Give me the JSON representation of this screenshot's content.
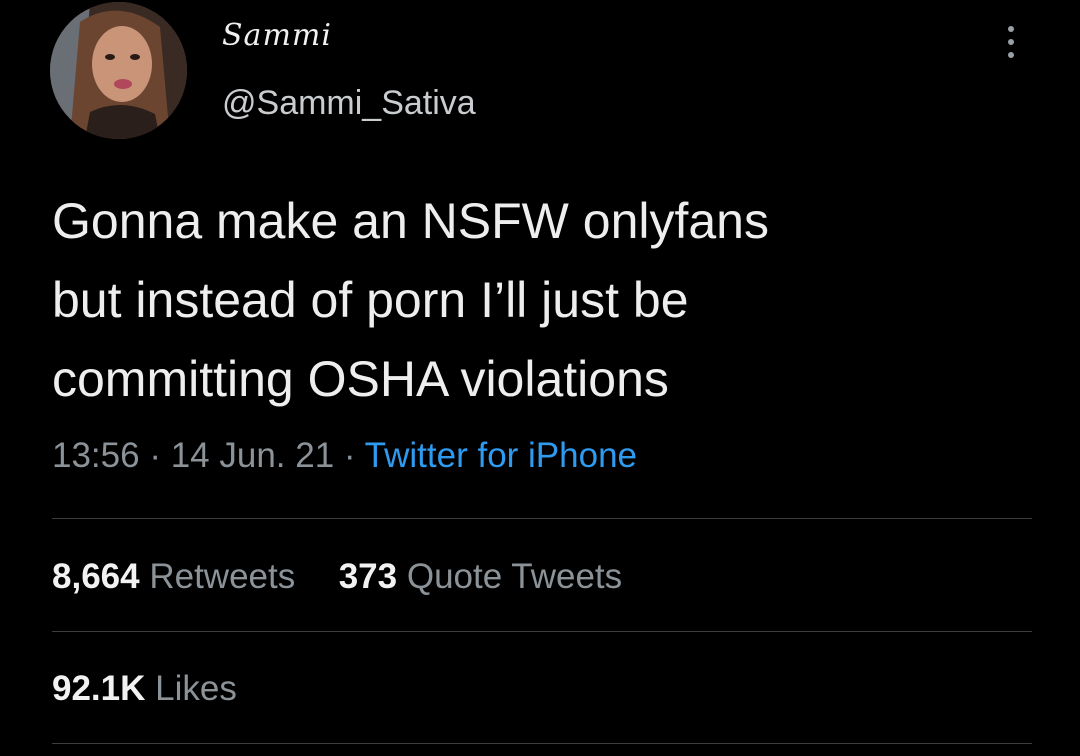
{
  "author": {
    "display_name": "Sammi",
    "handle": "@Sammi_Sativa",
    "avatar_icon": "user-avatar"
  },
  "tweet": {
    "text": "Gonna make an NSFW onlyfans\nbut instead of porn I’ll just be\ncommitting OSHA violations",
    "time": "13:56",
    "separator": "·",
    "date": "14 Jun. 21",
    "source": "Twitter for iPhone"
  },
  "stats": {
    "retweets_count": "8,664",
    "retweets_label": "Retweets",
    "quotes_count": "373",
    "quotes_label": "Quote Tweets",
    "likes_count": "92.1K",
    "likes_label": "Likes"
  },
  "colors": {
    "background": "#000000",
    "text": "#eeeeee",
    "muted": "#8b9298",
    "link": "#2f9bf0",
    "divider": "#3a3d40"
  },
  "icons": {
    "more": "more-vertical-icon"
  }
}
